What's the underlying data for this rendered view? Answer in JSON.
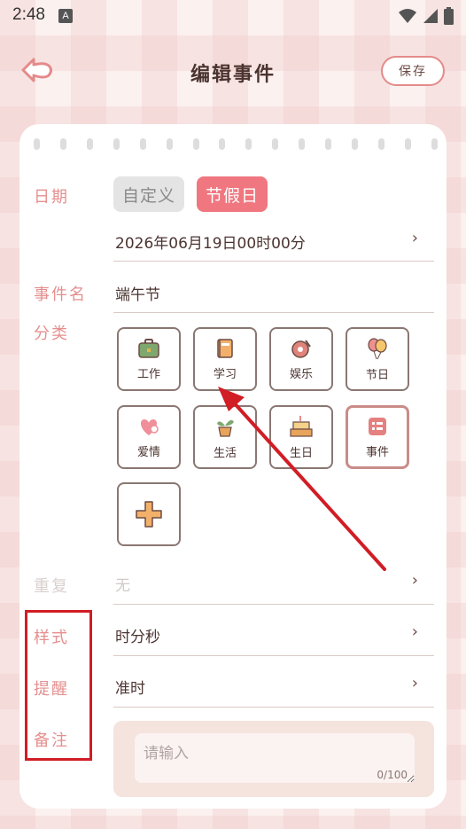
{
  "status": {
    "time": "2:48",
    "notif": "A"
  },
  "header": {
    "title": "编辑事件",
    "save_label": "保存"
  },
  "form": {
    "date_label": "日期",
    "date_types": [
      {
        "label": "自定义",
        "selected": false
      },
      {
        "label": "节假日",
        "selected": true
      }
    ],
    "date_value": "2026年06月19日00时00分",
    "event_name_label": "事件名",
    "event_name_value": "端午节",
    "category_label": "分类",
    "categories": [
      {
        "label": "工作",
        "icon": "briefcase-icon"
      },
      {
        "label": "学习",
        "icon": "book-icon"
      },
      {
        "label": "娱乐",
        "icon": "record-icon"
      },
      {
        "label": "节日",
        "icon": "balloon-icon"
      },
      {
        "label": "爱情",
        "icon": "heart-icon"
      },
      {
        "label": "生活",
        "icon": "plant-icon"
      },
      {
        "label": "生日",
        "icon": "cake-icon"
      },
      {
        "label": "事件",
        "icon": "event-icon",
        "selected": true
      }
    ],
    "repeat_label": "重复",
    "repeat_value": "无",
    "style_label": "样式",
    "style_value": "时分秒",
    "reminder_label": "提醒",
    "reminder_value": "准时",
    "notes_label": "备注",
    "notes_placeholder": "请输入",
    "notes_counter": "0/100"
  },
  "colors": {
    "accent": "#f0777f",
    "label": "#e58f8f",
    "annotation": "#d11d25"
  }
}
